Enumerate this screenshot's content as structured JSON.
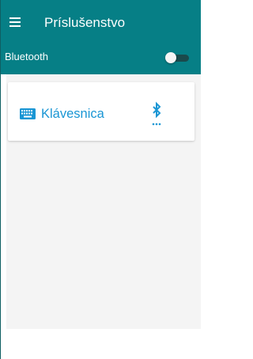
{
  "header": {
    "title": "Príslušenstvo",
    "menu_icon": "menu-icon"
  },
  "bluetooth": {
    "label": "Bluetooth",
    "enabled": false
  },
  "devices": [
    {
      "name": "Klávesnica",
      "type_icon": "keyboard-icon",
      "connection_icon": "bluetooth-searching-icon"
    }
  ],
  "colors": {
    "toolbar": "#067f86",
    "accent": "#1a96d4",
    "toggle_track": "#1a4a4c",
    "content_background": "#f4f4f4"
  }
}
